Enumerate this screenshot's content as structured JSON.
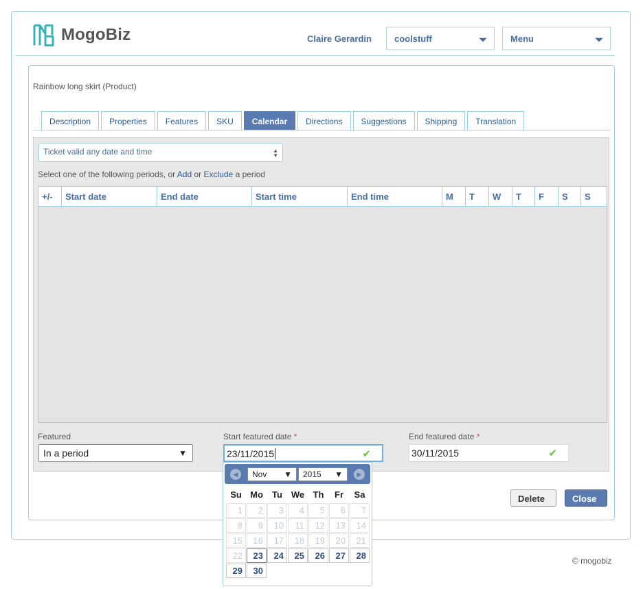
{
  "app": {
    "logo_text": "MogoBiz"
  },
  "header": {
    "user_name": "Claire Gerardin",
    "store_select": "coolstuff",
    "menu_select": "Menu"
  },
  "product": {
    "title": "Rainbow long skirt (Product)"
  },
  "tabs": [
    {
      "label": "Description"
    },
    {
      "label": "Properties"
    },
    {
      "label": "Features"
    },
    {
      "label": "SKU"
    },
    {
      "label": "Calendar",
      "active": true
    },
    {
      "label": "Directions"
    },
    {
      "label": "Suggestions"
    },
    {
      "label": "Shipping"
    },
    {
      "label": "Translation"
    }
  ],
  "calendar": {
    "ticket_select": "Ticket valid any date and time",
    "periods_prefix": "Select one of the following periods, or",
    "add_link": "Add",
    "or_text": "or",
    "exclude_link": "Exclude",
    "periods_suffix": "a period",
    "columns": [
      "+/-",
      "Start date",
      "End date",
      "Start time",
      "End time",
      "M",
      "T",
      "W",
      "T",
      "F",
      "S",
      "S"
    ],
    "rows": []
  },
  "featured": {
    "label": "Featured",
    "value": "In a period",
    "start_label": "Start featured date",
    "start_value": "23/11/2015",
    "end_label": "End featured date",
    "end_value": "30/11/2015",
    "required_mark": "*"
  },
  "buttons": {
    "delete": "Delete",
    "close": "Close"
  },
  "footer": {
    "copyright": "© mogobiz"
  },
  "datepicker": {
    "month": "Nov",
    "year": "2015",
    "weekdays": [
      "Su",
      "Mo",
      "Tu",
      "We",
      "Th",
      "Fr",
      "Sa"
    ],
    "weeks": [
      [
        1,
        2,
        3,
        4,
        5,
        6,
        7
      ],
      [
        8,
        9,
        10,
        11,
        12,
        13,
        14
      ],
      [
        15,
        16,
        17,
        18,
        19,
        20,
        21
      ],
      [
        22,
        23,
        24,
        25,
        26,
        27,
        28
      ],
      [
        29,
        30,
        null,
        null,
        null,
        null,
        null
      ]
    ],
    "first_selectable_day": 23,
    "current_day": 23
  },
  "colors": {
    "accent": "#5a7bb0",
    "border": "#9ecfe0",
    "link": "#2a5a90",
    "check": "#6bc04b",
    "logo_teal": "#35b3b5"
  }
}
